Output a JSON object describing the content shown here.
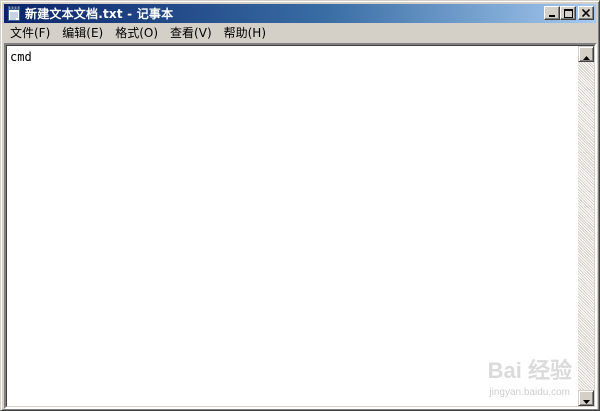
{
  "window": {
    "title": "新建文本文档.txt - 记事本",
    "icon": "notepad-icon"
  },
  "title_buttons": {
    "minimize": "minimize-icon",
    "maximize": "maximize-icon",
    "close": "close-icon"
  },
  "menu": [
    {
      "label": "文件(F)"
    },
    {
      "label": "编辑(E)"
    },
    {
      "label": "格式(O)"
    },
    {
      "label": "查看(V)"
    },
    {
      "label": "帮助(H)"
    }
  ],
  "editor": {
    "content": "cmd"
  },
  "watermark": {
    "brand": "Bai  经验",
    "url": "jingyan.baidu.com"
  },
  "colors": {
    "titlebar_start": "#0a246a",
    "titlebar_end": "#a6caf0",
    "chrome": "#d4d0c8"
  }
}
